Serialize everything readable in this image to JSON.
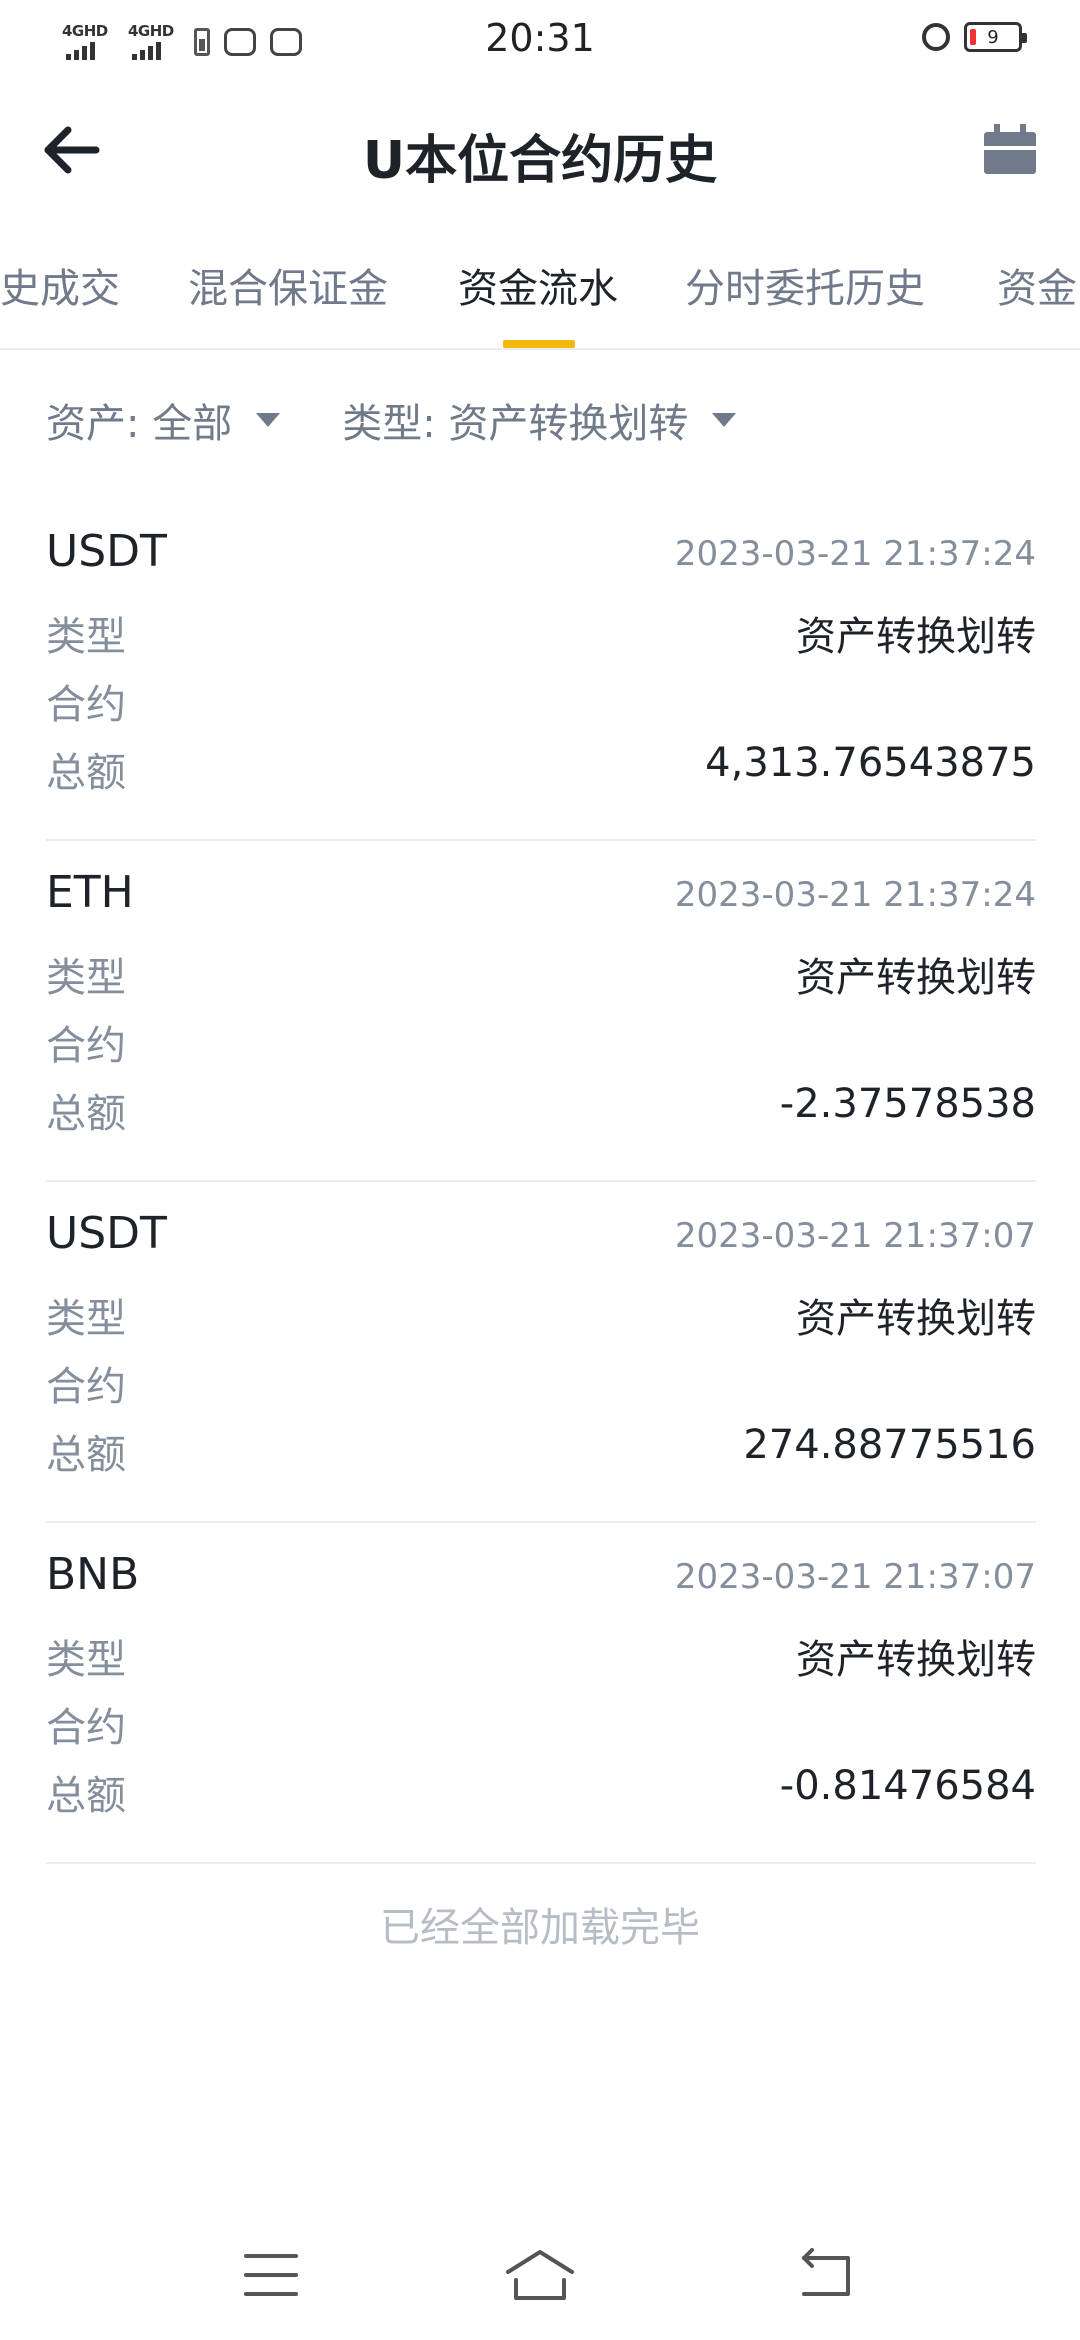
{
  "status_bar": {
    "time": "20:31",
    "signal_1_label": "4GHD",
    "signal_2_label": "4GHD",
    "battery_level": "9"
  },
  "header": {
    "title": "U本位合约历史",
    "back_icon": "back-arrow-icon",
    "calendar_icon": "calendar-icon"
  },
  "tabs": [
    {
      "label": "史成交"
    },
    {
      "label": "混合保证金"
    },
    {
      "label": "资金流水",
      "active": true
    },
    {
      "label": "分时委托历史"
    },
    {
      "label": "资金"
    }
  ],
  "filters": {
    "asset": "资产: 全部",
    "type": "类型: 资产转换划转"
  },
  "records": [
    {
      "asset": "USDT",
      "time": "2023-03-21 21:37:24",
      "type_label": "类型",
      "type_value": "资产转换划转",
      "contract_label": "合约",
      "contract_value": "",
      "amount_label": "总额",
      "amount_value": "4,313.76543875"
    },
    {
      "asset": "ETH",
      "time": "2023-03-21 21:37:24",
      "type_label": "类型",
      "type_value": "资产转换划转",
      "contract_label": "合约",
      "contract_value": "",
      "amount_label": "总额",
      "amount_value": "-2.37578538"
    },
    {
      "asset": "USDT",
      "time": "2023-03-21 21:37:07",
      "type_label": "类型",
      "type_value": "资产转换划转",
      "contract_label": "合约",
      "contract_value": "",
      "amount_label": "总额",
      "amount_value": "274.88775516"
    },
    {
      "asset": "BNB",
      "time": "2023-03-21 21:37:07",
      "type_label": "类型",
      "type_value": "资产转换划转",
      "contract_label": "合约",
      "contract_value": "",
      "amount_label": "总额",
      "amount_value": "-0.81476584"
    }
  ],
  "end_note": "已经全部加载完毕",
  "colors": {
    "accent": "#f0b90b",
    "text_primary": "#1e2329",
    "text_secondary": "#848e9c",
    "divider": "#eaecef"
  }
}
